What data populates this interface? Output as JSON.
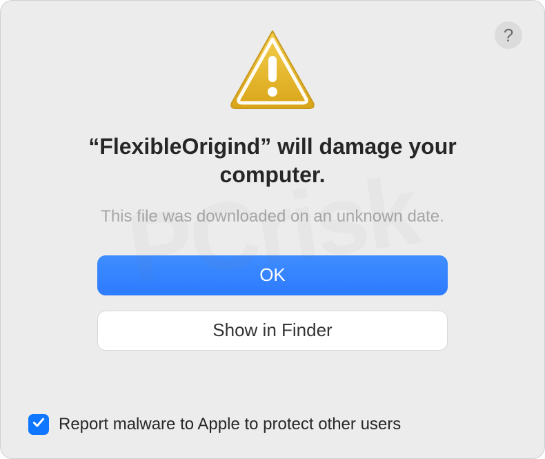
{
  "help": {
    "label": "?"
  },
  "dialog": {
    "title": "“FlexibleOrigind” will damage your computer.",
    "subtitle": "This file was downloaded on an unknown date."
  },
  "buttons": {
    "primary": "OK",
    "secondary": "Show in Finder"
  },
  "checkbox": {
    "checked": true,
    "label": "Report malware to Apple to protect other users"
  },
  "icons": {
    "warning": "warning-triangle",
    "help": "question-mark",
    "check": "checkmark"
  }
}
